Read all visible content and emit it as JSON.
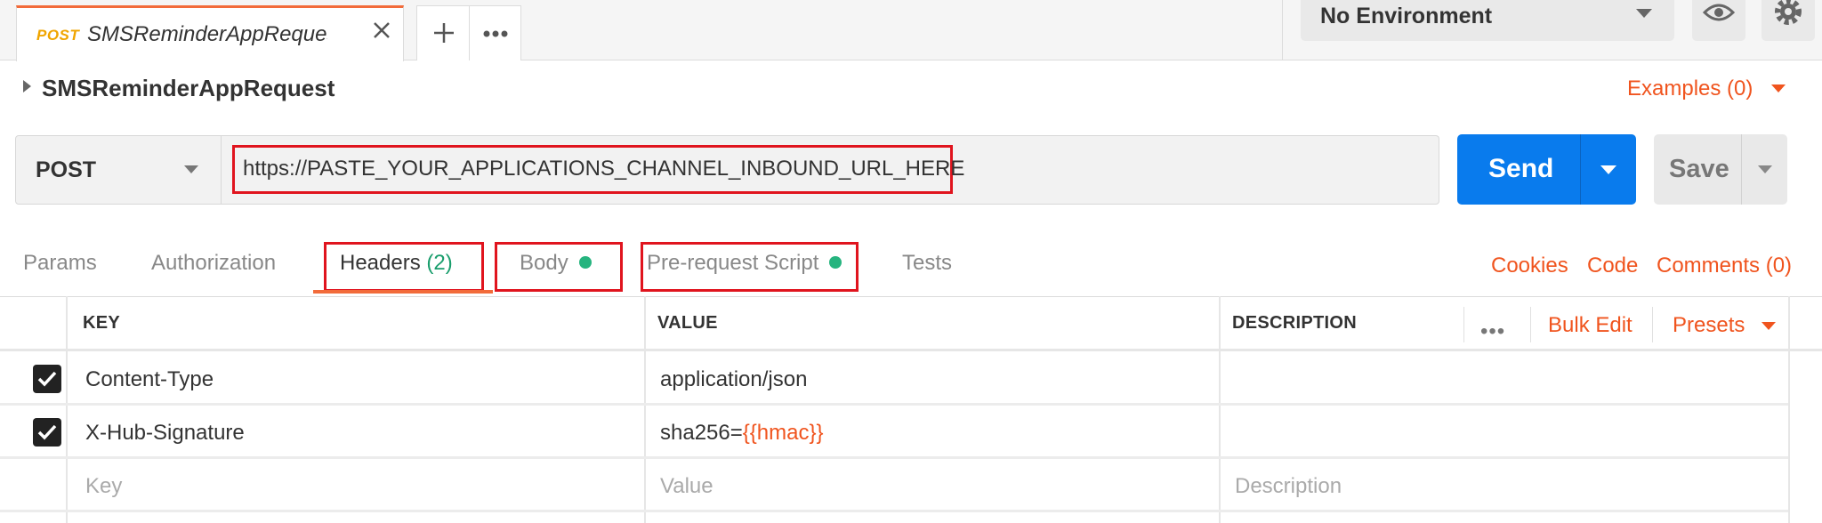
{
  "tab": {
    "method": "POST",
    "title": "SMSReminderAppRequest"
  },
  "environment": {
    "selected": "No Environment"
  },
  "request": {
    "name": "SMSReminderAppRequest",
    "examples_label": "Examples (0)",
    "method": "POST",
    "url": "https://PASTE_YOUR_APPLICATIONS_CHANNEL_INBOUND_URL_HERE",
    "send_label": "Send",
    "save_label": "Save"
  },
  "subtabs": {
    "params": "Params",
    "authorization": "Authorization",
    "headers": "Headers",
    "headers_count": "(2)",
    "body": "Body",
    "prerequest": "Pre-request Script",
    "tests": "Tests"
  },
  "links": {
    "cookies": "Cookies",
    "code": "Code",
    "comments": "Comments (0)"
  },
  "table": {
    "columns": [
      "KEY",
      "VALUE",
      "DESCRIPTION"
    ],
    "more_label": "•••",
    "bulk_edit": "Bulk Edit",
    "presets": "Presets",
    "rows": [
      {
        "key": "Content-Type",
        "value": "application/json",
        "checked": true
      },
      {
        "key": "X-Hub-Signature",
        "value_prefix": "sha256=",
        "value_var": "{{hmac}}",
        "checked": true
      }
    ],
    "placeholders": {
      "key": "Key",
      "value": "Value",
      "description": "Description"
    }
  },
  "colors": {
    "accent": "#f0541e",
    "send": "#097bed",
    "dot": "#26b47f",
    "highlight": "#e0141e"
  }
}
